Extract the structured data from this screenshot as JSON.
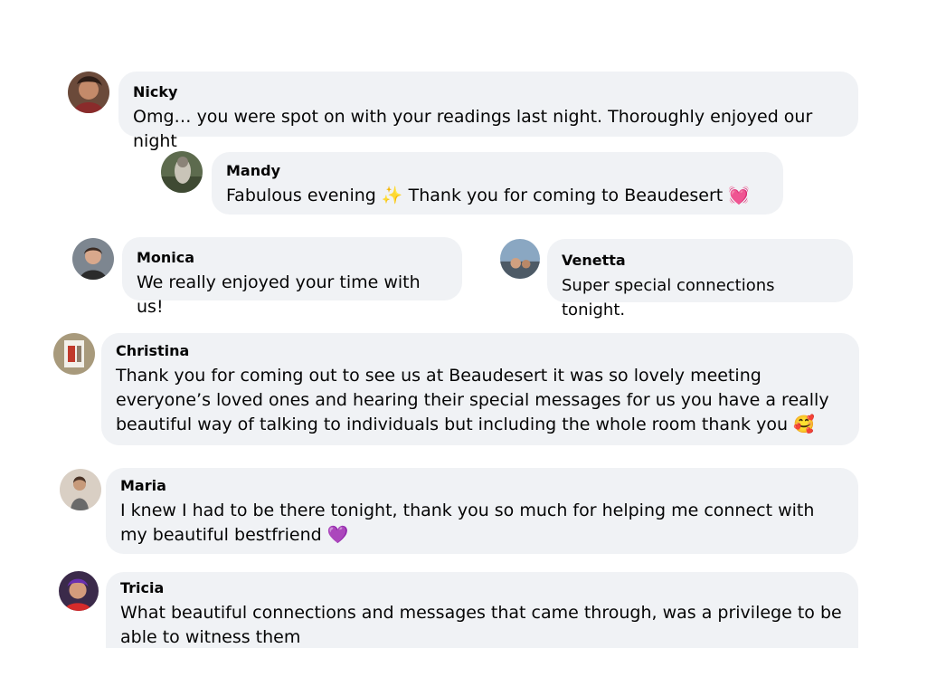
{
  "comments": [
    {
      "name": "Nicky",
      "text": "Omg… you were spot on with your readings last night. Thoroughly enjoyed our night",
      "emoji": "",
      "avatar_icon": "profile-photo-avatar"
    },
    {
      "name": "Mandy",
      "text_before": "Fabulous evening ",
      "sparkles_emoji": "✨",
      "text_after": " Thank you for coming to Beaudesert ",
      "emoji": "💓",
      "avatar_icon": "profile-photo-avatar"
    },
    {
      "name": "Monica",
      "text": "We really enjoyed your time with us!",
      "emoji": "",
      "avatar_icon": "profile-photo-avatar"
    },
    {
      "name": "Venetta",
      "text": "Super special connections tonight.",
      "emoji": "",
      "avatar_icon": "profile-photo-avatar"
    },
    {
      "name": "Christina",
      "text": "Thank you for coming out to see us at Beaudesert it was so lovely meeting everyone’s loved ones and hearing their special messages for us you have a really beautiful way of talking to individuals but including the whole room thank you ",
      "emoji": "🥰",
      "avatar_icon": "profile-photo-avatar"
    },
    {
      "name": "Maria",
      "text": "I knew I had to be there tonight, thank you so much for helping me connect with my beautiful bestfriend ",
      "emoji": "💜",
      "avatar_icon": "profile-photo-avatar"
    },
    {
      "name": "Tricia",
      "text": "What beautiful connections and messages that came through, was a privilege to be able to witness them",
      "emoji": "",
      "avatar_icon": "profile-photo-avatar"
    }
  ],
  "colors": {
    "bubble_background": "#f0f2f5",
    "text": "#050505",
    "page_background": "#ffffff"
  }
}
